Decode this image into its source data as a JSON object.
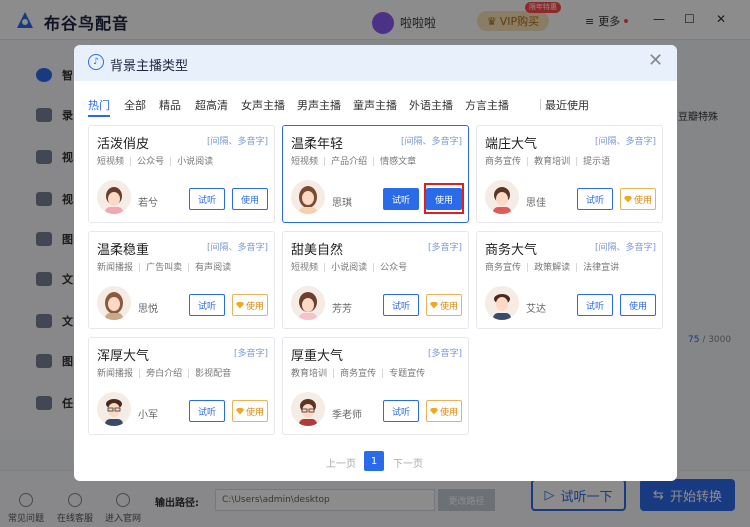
{
  "app": {
    "title": "布谷鸟配音",
    "user_name": "啦啦啦",
    "vip_label": "VIP购买",
    "vip_badge": "限年特惠",
    "more_label": "更多",
    "minimize": "—",
    "maximize": "☐",
    "close": "✕"
  },
  "sidebar": {
    "items": [
      {
        "label": "智",
        "icon": "smart-icon"
      },
      {
        "label": "录",
        "icon": "record-icon"
      },
      {
        "label": "视",
        "icon": "video-icon"
      },
      {
        "label": "视",
        "icon": "video-icon"
      },
      {
        "label": "图",
        "icon": "image-icon"
      },
      {
        "label": "文",
        "icon": "text-icon"
      },
      {
        "label": "文",
        "icon": "text-icon"
      },
      {
        "label": "图",
        "icon": "image-icon"
      },
      {
        "label": "任",
        "icon": "task-icon"
      }
    ]
  },
  "background": {
    "right_label": "豆瓣特殊",
    "counter_current": "75",
    "counter_total": " / 3000"
  },
  "bottom": {
    "links": [
      "常见问题",
      "在线客服",
      "进入官网"
    ],
    "output_label": "输出路径:",
    "output_path": "C:\\Users\\admin\\desktop",
    "change_path_label": "更改路径",
    "listen_label": "试听一下",
    "convert_label": "开始转换"
  },
  "modal": {
    "title": "背景主播类型",
    "close": "✕",
    "tabs": [
      "热门",
      "全部",
      "精品",
      "超高清",
      "女声主播",
      "男声主播",
      "童声主播",
      "外语主播",
      "方言主播",
      "最近使用"
    ],
    "active_tab": "热门",
    "cards": [
      {
        "name": "活泼俏皮",
        "lang": "[间隔、多音字]",
        "tags": [
          "短视频",
          "公众号",
          "小说阅读"
        ],
        "person": "若兮",
        "listen": "试听",
        "use": "使用",
        "use_vip": false,
        "selected": false
      },
      {
        "name": "温柔年轻",
        "lang": "[间隔、多音字]",
        "tags": [
          "短视频",
          "产品介绍",
          "情感文章"
        ],
        "person": "思琪",
        "listen": "试听",
        "use": "使用",
        "use_vip": false,
        "selected": true
      },
      {
        "name": "端庄大气",
        "lang": "[间隔、多音字]",
        "tags": [
          "商务宣传",
          "教育培训",
          "提示语"
        ],
        "person": "思佳",
        "listen": "试听",
        "use": "使用",
        "use_vip": true,
        "selected": false
      },
      {
        "name": "温柔稳重",
        "lang": "[间隔、多音字]",
        "tags": [
          "新闻播报",
          "广告叫卖",
          "有声阅读"
        ],
        "person": "思悦",
        "listen": "试听",
        "use": "使用",
        "use_vip": true,
        "selected": false
      },
      {
        "name": "甜美自然",
        "lang": "[多音字]",
        "tags": [
          "短视频",
          "小说阅读",
          "公众号"
        ],
        "person": "芳芳",
        "listen": "试听",
        "use": "使用",
        "use_vip": true,
        "selected": false
      },
      {
        "name": "商务大气",
        "lang": "[间隔、多音字]",
        "tags": [
          "商务宣传",
          "政策解读",
          "法律宣讲"
        ],
        "person": "艾达",
        "listen": "试听",
        "use": "使用",
        "use_vip": false,
        "selected": false
      },
      {
        "name": "浑厚大气",
        "lang": "[多音字]",
        "tags": [
          "新闻播报",
          "旁白介绍",
          "影视配音"
        ],
        "person": "小军",
        "listen": "试听",
        "use": "使用",
        "use_vip": true,
        "selected": false
      },
      {
        "name": "厚重大气",
        "lang": "[多音字]",
        "tags": [
          "教育培训",
          "商务宣传",
          "专题宣传"
        ],
        "person": "季老师",
        "listen": "试听",
        "use": "使用",
        "use_vip": true,
        "selected": false
      }
    ],
    "pager": {
      "prev": "上一页",
      "current": "1",
      "next": "下一页"
    }
  }
}
